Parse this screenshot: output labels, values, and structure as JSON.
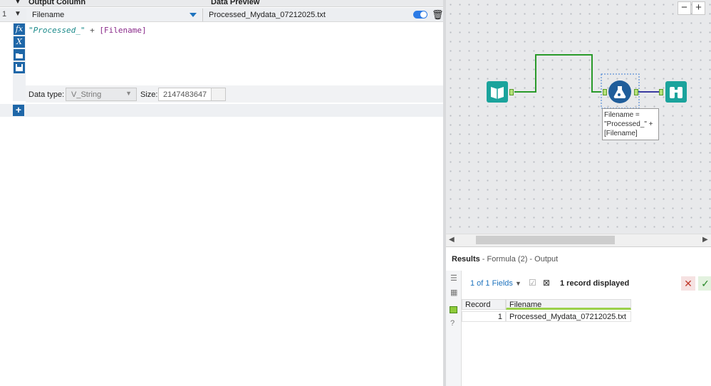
{
  "formula_grid": {
    "headers": {
      "output_column": "Output Column",
      "data_preview": "Data Preview"
    },
    "row": {
      "number": "1",
      "field": "Filename",
      "preview": "Processed_Mydata_07212025.txt"
    },
    "tool_icons": [
      "function-icon",
      "variable-icon",
      "open-expression-icon",
      "save-expression-icon"
    ],
    "tool_glyphs": {
      "fx": "fx",
      "x": "X"
    },
    "expression": {
      "string": "\"Processed_\"",
      "operator": " + ",
      "field": "[Filename]"
    },
    "data_type_label": "Data type:",
    "data_type_value": "V_String",
    "size_label": "Size:",
    "size_value": "2147483647",
    "add_label": "+"
  },
  "canvas": {
    "zoom_out": "−",
    "zoom_in": "+",
    "annotation": "Filename = \"Processed_\" + [Filename]",
    "colors": {
      "teal": "#1ba39c",
      "formula_blue": "#1f5d9a",
      "connection_green": "#2a9a2a",
      "connection_blue": "#2a3a9a"
    }
  },
  "results": {
    "title_bold": "Results",
    "title_rest": " - Formula (2) - Output",
    "fields_label": "1 of 1 Fields",
    "records_label": "1 record displayed",
    "table": {
      "headers": [
        "Record",
        "Filename"
      ],
      "rows": [
        {
          "record": "1",
          "filename": "Processed_Mydata_07212025.txt"
        }
      ]
    },
    "cancel_glyph": "✕",
    "apply_glyph": "✓"
  }
}
